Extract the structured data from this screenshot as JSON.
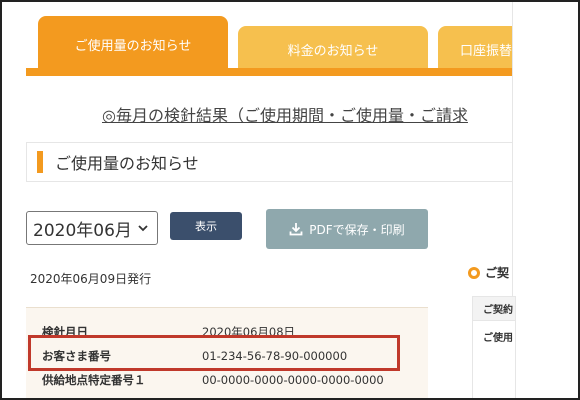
{
  "tabs": [
    {
      "label": "ご使用量のお知らせ",
      "active": true
    },
    {
      "label": "料金のお知らせ",
      "active": false
    },
    {
      "label": "口座振替",
      "active": false
    }
  ],
  "headline": "◎毎月の検針結果（ご使用期間・ご使用量・ご請求",
  "section_title": "ご使用量のお知らせ",
  "month_select": {
    "value": "2020年06月"
  },
  "buttons": {
    "show": "表示",
    "pdf": "PDFで保存・印刷"
  },
  "issued_date": "2020年06月09日発行",
  "info_rows": [
    {
      "label": "検針月日",
      "value": "2020年06月08日"
    },
    {
      "label": "お客さま番号",
      "value": "01-234-56-78-90-000000"
    },
    {
      "label": "供給地点特定番号１",
      "value": "00-0000-0000-0000-0000-0000"
    }
  ],
  "right_panel": {
    "title": "ご契",
    "row1": "ご契約",
    "row2": "ご使用"
  },
  "colors": {
    "accent": "#f39a1f",
    "tab_inactive": "#f6c04e",
    "show_button": "#3b4f6c",
    "pdf_button": "#8fa8ad",
    "highlight": "#c0392b"
  },
  "icons": {
    "pdf": "download-icon",
    "select": "chevron-down-icon",
    "right_panel": "circle-marker-icon"
  }
}
